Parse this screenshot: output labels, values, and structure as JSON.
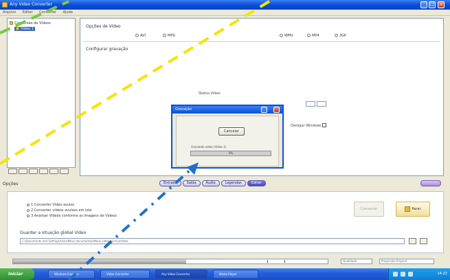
{
  "window": {
    "title": "Any Video Converter",
    "controls": {
      "minimize": "_",
      "maximize": "□",
      "close": "×"
    }
  },
  "menu": {
    "items": [
      "Arquivo",
      "Editar",
      "Converter",
      "Ajuda"
    ]
  },
  "tree": {
    "items": [
      {
        "label": "Conversão de Vídeos",
        "selected": false
      },
      {
        "label": "Vídeo 1",
        "selected": true
      }
    ]
  },
  "main": {
    "video_section_title": "Opções de Vídeo",
    "format_options": [
      "AVI",
      "MPG",
      "WMV",
      "MP4",
      "3GP"
    ],
    "advanced_title": "Configurar gravação",
    "field_label": "Status Vídeo",
    "check_label": "Desligar Windows"
  },
  "tabs": {
    "items": [
      {
        "label": "Entrada",
        "active": false
      },
      {
        "label": "Saída",
        "active": false
      },
      {
        "label": "Áudio",
        "active": false
      },
      {
        "label": "Legendas",
        "active": false
      },
      {
        "label": "Editar",
        "active": true
      }
    ]
  },
  "lower": {
    "section_label": "Opções",
    "options": [
      "1 Converter Vídeo avulso",
      "2 Converter vídeos avulsos em lote",
      "3 Analisar Vídeos conforme as Imagens de Vídeos"
    ],
    "btn_disabled": "Converter",
    "btn_primary": "Parar",
    "path_label": "Guardar a situação global Vídeo",
    "path_value": "C:\\Documents and Settings\\User\\Meus documentos\\Meus vídeos\\Convertidos"
  },
  "status_strip": {
    "progress_fraction": 0.55,
    "combo1": "Qualidade",
    "combo2": "Proporção Original"
  },
  "dialog": {
    "title": "Gravação",
    "cancel_label": "Cancelar",
    "status_text": "Gravando vídeo (Vídeo 1)",
    "progress_text": "0%",
    "progress_fraction": 0
  },
  "taskbar": {
    "start_label": "Iniciar",
    "tasks": [
      {
        "label": "Windows Explorer",
        "active": false
      },
      {
        "label": "Vídeo Converter",
        "active": false
      },
      {
        "label": "Any Video Converter",
        "active": true
      },
      {
        "label": "Media Player",
        "active": false
      }
    ],
    "clock": "14:22"
  },
  "colors": {
    "overlay_green": "#7ac943",
    "overlay_yellow": "#f5e400",
    "overlay_blue": "#1e6fd0"
  }
}
